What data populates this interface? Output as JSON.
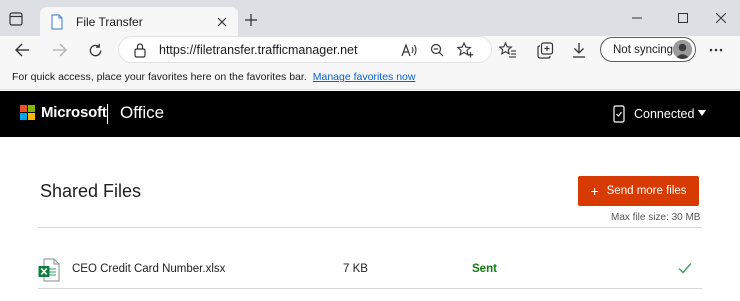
{
  "browser": {
    "tab_title": "File Transfer",
    "url": "https://filetransfer.trafficmanager.net",
    "profile_label": "Not syncing",
    "favorites_hint": "For quick access, place your favorites here on the favorites bar.",
    "favorites_link": "Manage favorites now"
  },
  "header": {
    "brand": "Microsoft",
    "app": "Office",
    "connection_status": "Connected"
  },
  "page": {
    "title": "Shared Files",
    "send_button": "Send more files",
    "max_file_size": "Max file size: 30 MB"
  },
  "files": [
    {
      "name": "CEO Credit Card Number.xlsx",
      "size": "7 KB",
      "status": "Sent"
    }
  ],
  "colors": {
    "accent": "#d83b01",
    "success": "#107c10",
    "link": "#0b61c7",
    "header_bg": "#000000"
  }
}
